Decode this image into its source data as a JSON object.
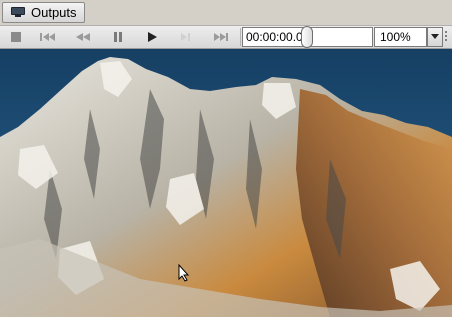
{
  "tab": {
    "label": "Outputs",
    "icon": "monitor-icon"
  },
  "toolbar": {
    "buttons": [
      "stop",
      "skip-to-start",
      "rewind",
      "pause",
      "play",
      "step-forward",
      "skip-to-end"
    ],
    "time": "00:00:00.0",
    "zoom": "100%",
    "zoom_arrow": "▾"
  },
  "colors": {
    "sky": "#1f4f78",
    "rock_light": "#e9e4d8",
    "rock_warm": "#c98a3e",
    "rock_shadow": "#4a4a48"
  }
}
